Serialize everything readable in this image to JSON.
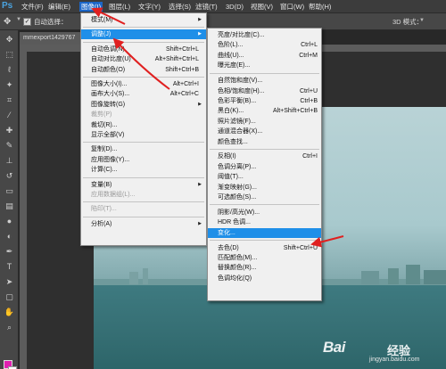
{
  "app": {
    "logo": "Ps"
  },
  "menubar": {
    "items": [
      {
        "label": "文件(F)"
      },
      {
        "label": "编辑(E)"
      },
      {
        "label": "图像(I)",
        "active": true
      },
      {
        "label": "图层(L)"
      },
      {
        "label": "文字(Y)"
      },
      {
        "label": "选择(S)"
      },
      {
        "label": "滤镜(T)"
      },
      {
        "label": "3D(D)"
      },
      {
        "label": "视图(V)"
      },
      {
        "label": "窗口(W)"
      },
      {
        "label": "帮助(H)"
      }
    ]
  },
  "options_bar": {
    "auto_select_label": "自动选择：",
    "auto_select_checked": true,
    "mode_3d_label": "3D 模式："
  },
  "document": {
    "tab_title": "mmexport1429767"
  },
  "image_menu": {
    "items": [
      {
        "label": "模式(M)",
        "shortcut": "",
        "submenu": true
      },
      {
        "sep": true
      },
      {
        "label": "调整(J)",
        "shortcut": "",
        "submenu": true,
        "highlighted": true
      },
      {
        "sep": true
      },
      {
        "label": "自动色调(N)",
        "shortcut": "Shift+Ctrl+L"
      },
      {
        "label": "自动对比度(U)",
        "shortcut": "Alt+Shift+Ctrl+L"
      },
      {
        "label": "自动颜色(O)",
        "shortcut": "Shift+Ctrl+B"
      },
      {
        "sep": true
      },
      {
        "label": "图像大小(I)...",
        "shortcut": "Alt+Ctrl+I"
      },
      {
        "label": "画布大小(S)...",
        "shortcut": "Alt+Ctrl+C"
      },
      {
        "label": "图像旋转(G)",
        "shortcut": "",
        "submenu": true
      },
      {
        "label": "裁剪(P)",
        "shortcut": "",
        "disabled": true
      },
      {
        "label": "裁切(R)...",
        "shortcut": ""
      },
      {
        "label": "显示全部(V)",
        "shortcut": ""
      },
      {
        "sep": true
      },
      {
        "label": "复制(D)...",
        "shortcut": ""
      },
      {
        "label": "应用图像(Y)...",
        "shortcut": ""
      },
      {
        "label": "计算(C)...",
        "shortcut": ""
      },
      {
        "sep": true
      },
      {
        "label": "变量(B)",
        "shortcut": "",
        "submenu": true
      },
      {
        "label": "应用数据组(L)...",
        "shortcut": "",
        "disabled": true
      },
      {
        "sep": true
      },
      {
        "label": "陷印(T)...",
        "shortcut": "",
        "disabled": true
      },
      {
        "sep": true
      },
      {
        "label": "分析(A)",
        "shortcut": "",
        "submenu": true
      }
    ]
  },
  "adjust_menu": {
    "items": [
      {
        "label": "亮度/对比度(C)...",
        "shortcut": ""
      },
      {
        "label": "色阶(L)...",
        "shortcut": "Ctrl+L"
      },
      {
        "label": "曲线(U)...",
        "shortcut": "Ctrl+M"
      },
      {
        "label": "曝光度(E)...",
        "shortcut": ""
      },
      {
        "sep": true
      },
      {
        "label": "自然饱和度(V)...",
        "shortcut": ""
      },
      {
        "label": "色相/饱和度(H)...",
        "shortcut": "Ctrl+U"
      },
      {
        "label": "色彩平衡(B)...",
        "shortcut": "Ctrl+B"
      },
      {
        "label": "黑白(K)...",
        "shortcut": "Alt+Shift+Ctrl+B"
      },
      {
        "label": "照片滤镜(F)...",
        "shortcut": ""
      },
      {
        "label": "通道混合器(X)...",
        "shortcut": ""
      },
      {
        "label": "颜色查找...",
        "shortcut": ""
      },
      {
        "sep": true
      },
      {
        "label": "反相(I)",
        "shortcut": "Ctrl+I"
      },
      {
        "label": "色调分离(P)...",
        "shortcut": ""
      },
      {
        "label": "阈值(T)...",
        "shortcut": ""
      },
      {
        "label": "渐变映射(G)...",
        "shortcut": ""
      },
      {
        "label": "可选颜色(S)...",
        "shortcut": ""
      },
      {
        "sep": true
      },
      {
        "label": "阴影/高光(W)...",
        "shortcut": ""
      },
      {
        "label": "HDR 色调...",
        "shortcut": ""
      },
      {
        "label": "变化...",
        "shortcut": "",
        "highlighted": true
      },
      {
        "sep": true
      },
      {
        "label": "去色(D)",
        "shortcut": "Shift+Ctrl+U"
      },
      {
        "label": "匹配颜色(M)...",
        "shortcut": ""
      },
      {
        "label": "替换颜色(R)...",
        "shortcut": ""
      },
      {
        "label": "色调均化(Q)",
        "shortcut": ""
      }
    ]
  },
  "colors": {
    "foreground": "#e020b0",
    "background": "#ffffff",
    "highlight": "#1f8fe8",
    "annotation_arrow": "#e02020"
  },
  "watermark": {
    "brand": "Bai",
    "brand_suffix": "经验",
    "url": "jingyan.baidu.com"
  }
}
